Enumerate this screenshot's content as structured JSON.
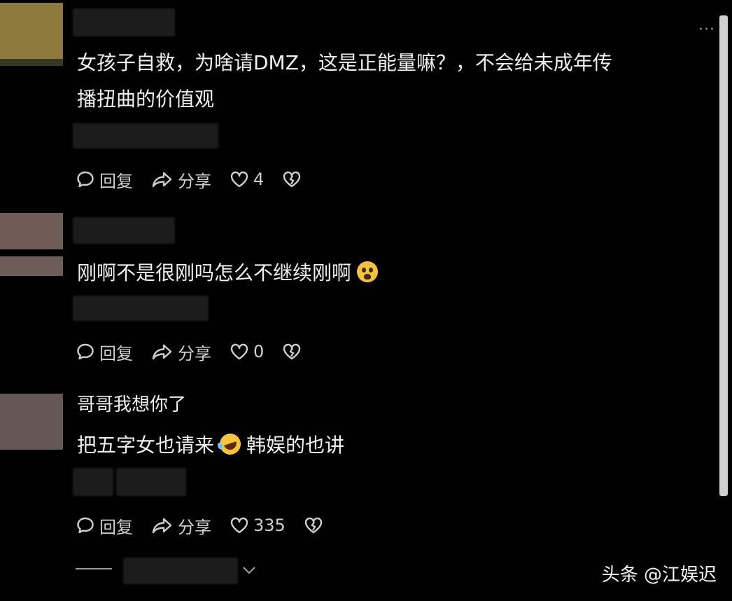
{
  "more_label": "···",
  "comments": [
    {
      "text_line1": "女孩子自救，为啥请DMZ，这是正能量嘛？，不会给未成年传",
      "text_line2": "播扭曲的价值观",
      "reply_label": "回复",
      "share_label": "分享",
      "like_count": "4"
    },
    {
      "text_line1": "刚啊不是很刚吗怎么不继续刚啊",
      "reply_label": "回复",
      "share_label": "分享",
      "like_count": "0"
    },
    {
      "quote_text": "哥哥我想你了",
      "text_part1": "把五字女也请来",
      "text_part2": "韩娱的也讲",
      "reply_label": "回复",
      "share_label": "分享",
      "like_count": "335"
    }
  ],
  "watermark": "头条 @江娱迟",
  "icons": {
    "reply": "speech-bubble-icon",
    "share": "share-arrow-icon",
    "like": "heart-icon",
    "dislike": "broken-heart-icon",
    "expand": "chevron-down-icon",
    "more": "ellipsis-icon"
  },
  "colors": {
    "background": "#000000",
    "text": "#f1f1f1",
    "action_text": "#cfcfcf",
    "avatar1": "#8f7a3e",
    "avatar2": "#6e5c56",
    "avatar3": "#665555"
  }
}
